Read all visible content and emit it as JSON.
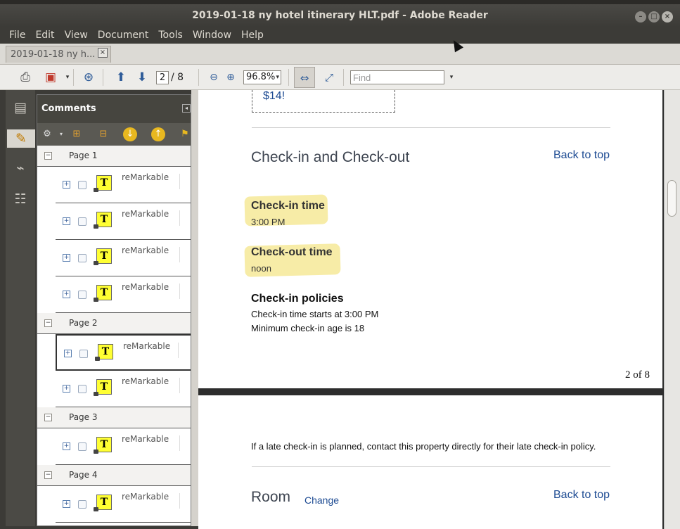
{
  "window": {
    "title": "2019-01-18 ny hotel itinerary HLT.pdf - Adobe Reader"
  },
  "menubar": [
    "File",
    "Edit",
    "View",
    "Document",
    "Tools",
    "Window",
    "Help"
  ],
  "tab": {
    "label": "2019-01-18 ny h..."
  },
  "toolbar": {
    "current_page": "2",
    "total_pages": "/ 8",
    "zoom": "96.8%",
    "find_placeholder": "Find"
  },
  "comments": {
    "header": "Comments",
    "groups": [
      {
        "label": "Page 1",
        "items": [
          "reMarkable",
          "reMarkable",
          "reMarkable",
          "reMarkable"
        ]
      },
      {
        "label": "Page 2",
        "items": [
          "reMarkable",
          "reMarkable"
        ]
      },
      {
        "label": "Page 3",
        "items": [
          "reMarkable"
        ]
      },
      {
        "label": "Page 4",
        "items": [
          "reMarkable"
        ]
      }
    ]
  },
  "document": {
    "prev_box_text": "$14!",
    "section1_title": "Check-in and Check-out",
    "back_to_top_1": "Back to top",
    "checkin_label": "Check-in time",
    "checkin_value": "3:00 PM",
    "checkout_label": "Check-out time",
    "checkout_value": "noon",
    "policies_title": "Check-in policies",
    "policy_1": "Check-in time starts at 3:00 PM",
    "policy_2": "Minimum check-in age is 18",
    "page_counter": "2 of 8",
    "late_checkin": "If a late check-in is planned, contact this property directly for their late check-in policy.",
    "room_title": "Room",
    "room_change": "Change",
    "back_to_top_2": "Back to top"
  },
  "colors": {
    "link": "#1c4a92",
    "highlight": "#f4e482",
    "chrome_dark": "#3c3b37"
  }
}
